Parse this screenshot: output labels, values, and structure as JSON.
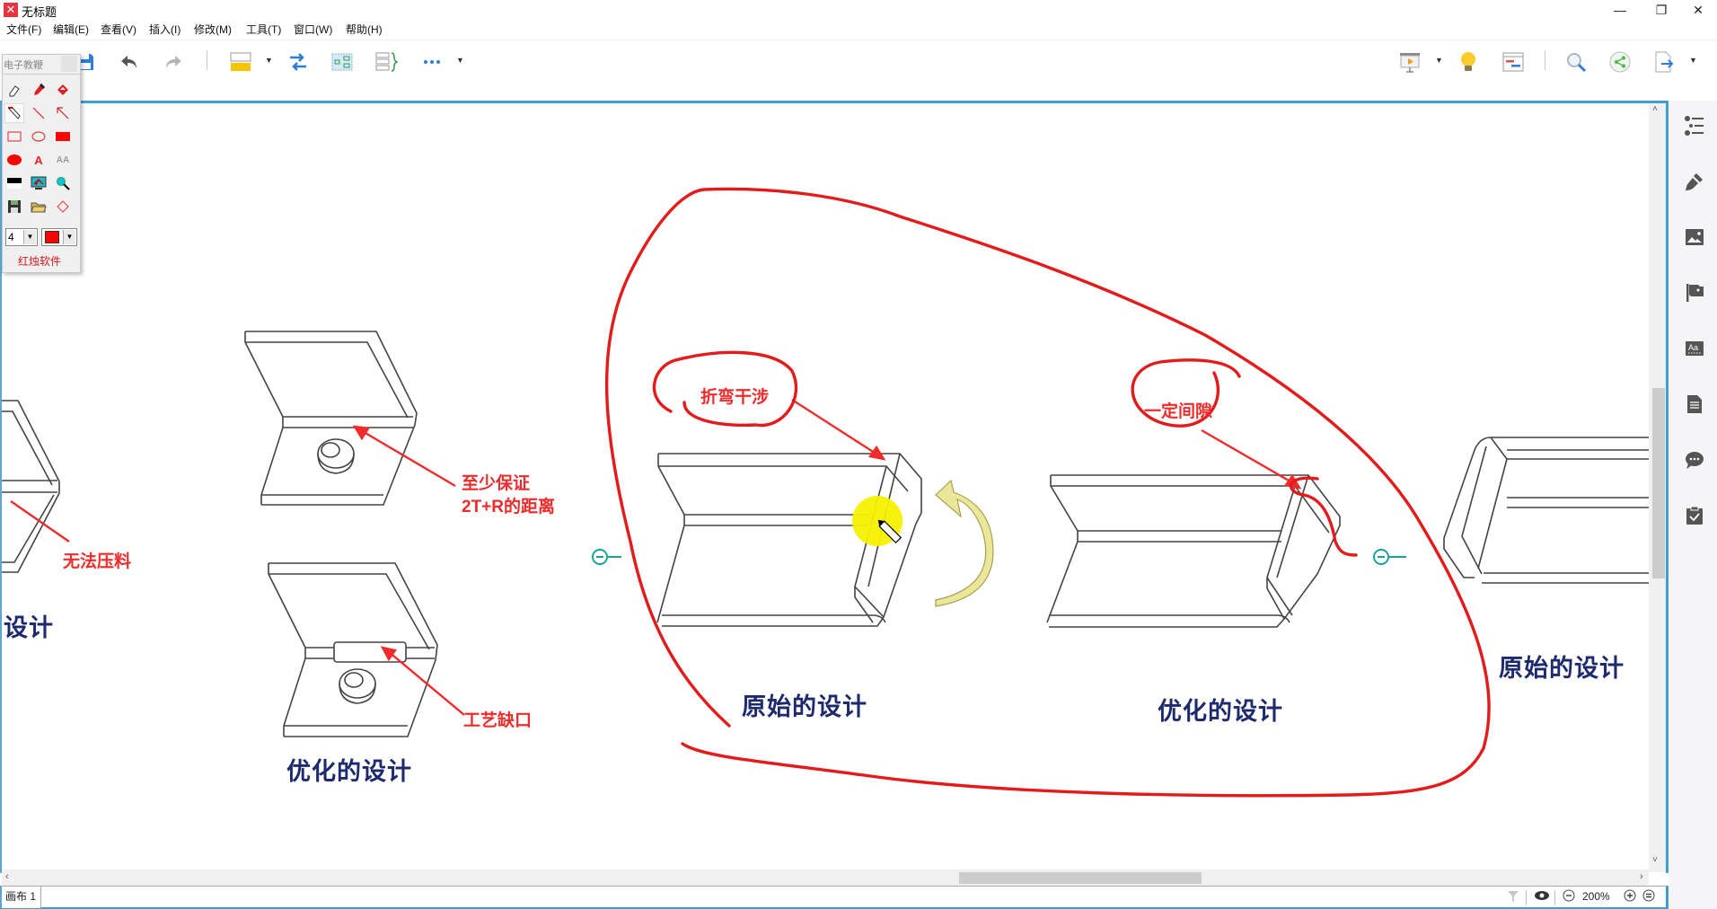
{
  "window": {
    "title": "无标题",
    "logo": "✕",
    "controls": {
      "minimize": "—",
      "restore": "❐",
      "close": "✕"
    }
  },
  "menu": [
    "文件(F)",
    "编辑(E)",
    "查看(V)",
    "插入(I)",
    "修改(M)",
    "工具(T)",
    "窗口(W)",
    "帮助(H)"
  ],
  "toolbar": {
    "left": [
      "home-icon",
      "save-icon",
      "undo-icon",
      "redo-icon",
      "topic-icon",
      "relationship-icon",
      "boundary-icon",
      "summary-icon",
      "more-icon"
    ],
    "right": [
      "presentation-icon",
      "brainstorm-icon",
      "gantt-icon",
      "search-icon",
      "share-icon",
      "export-icon"
    ]
  },
  "palette": {
    "title": "电子教鞭",
    "tools": [
      "eraser",
      "pen",
      "fill",
      "highlighter",
      "line",
      "arrow",
      "rectangle",
      "ellipse",
      "filled-rectangle",
      "filled-ellipse",
      "text",
      "font-size",
      "whiteboard",
      "screen",
      "magnifier",
      "save",
      "open",
      "clear"
    ],
    "line_width": "4",
    "color": "#ff0000",
    "brand": "红烛软件"
  },
  "canvas": {
    "labels": [
      {
        "id": "left-partial-label",
        "text": "设计"
      },
      {
        "id": "optimized-design-1",
        "text": "优化的设计"
      },
      {
        "id": "original-design-2",
        "text": "原始的设计"
      },
      {
        "id": "optimized-design-2",
        "text": "优化的设计"
      },
      {
        "id": "original-design-3",
        "text": "原始的设计"
      }
    ],
    "notes": [
      {
        "id": "cannot-press-note",
        "text": "无法压料"
      },
      {
        "id": "min-distance-note-1",
        "text": "至少保证"
      },
      {
        "id": "min-distance-note-2",
        "text": "2T+R的距离"
      },
      {
        "id": "process-notch-note",
        "text": "工艺缺口"
      },
      {
        "id": "bend-interference-note",
        "text": "折弯干涉"
      },
      {
        "id": "clearance-note",
        "text": "一定间隙"
      }
    ]
  },
  "statusbar": {
    "sheet": "画布 1",
    "zoom": "200%"
  },
  "rightbar": [
    "outline-icon",
    "format-icon",
    "image-icon",
    "marker-icon",
    "text-style-icon",
    "notes-icon",
    "comment-icon",
    "task-icon"
  ],
  "colors": {
    "accent": "#3fa0d0",
    "annotation": "#e31b1b",
    "label": "#1e2a6e",
    "highlight": "#f5f000"
  }
}
